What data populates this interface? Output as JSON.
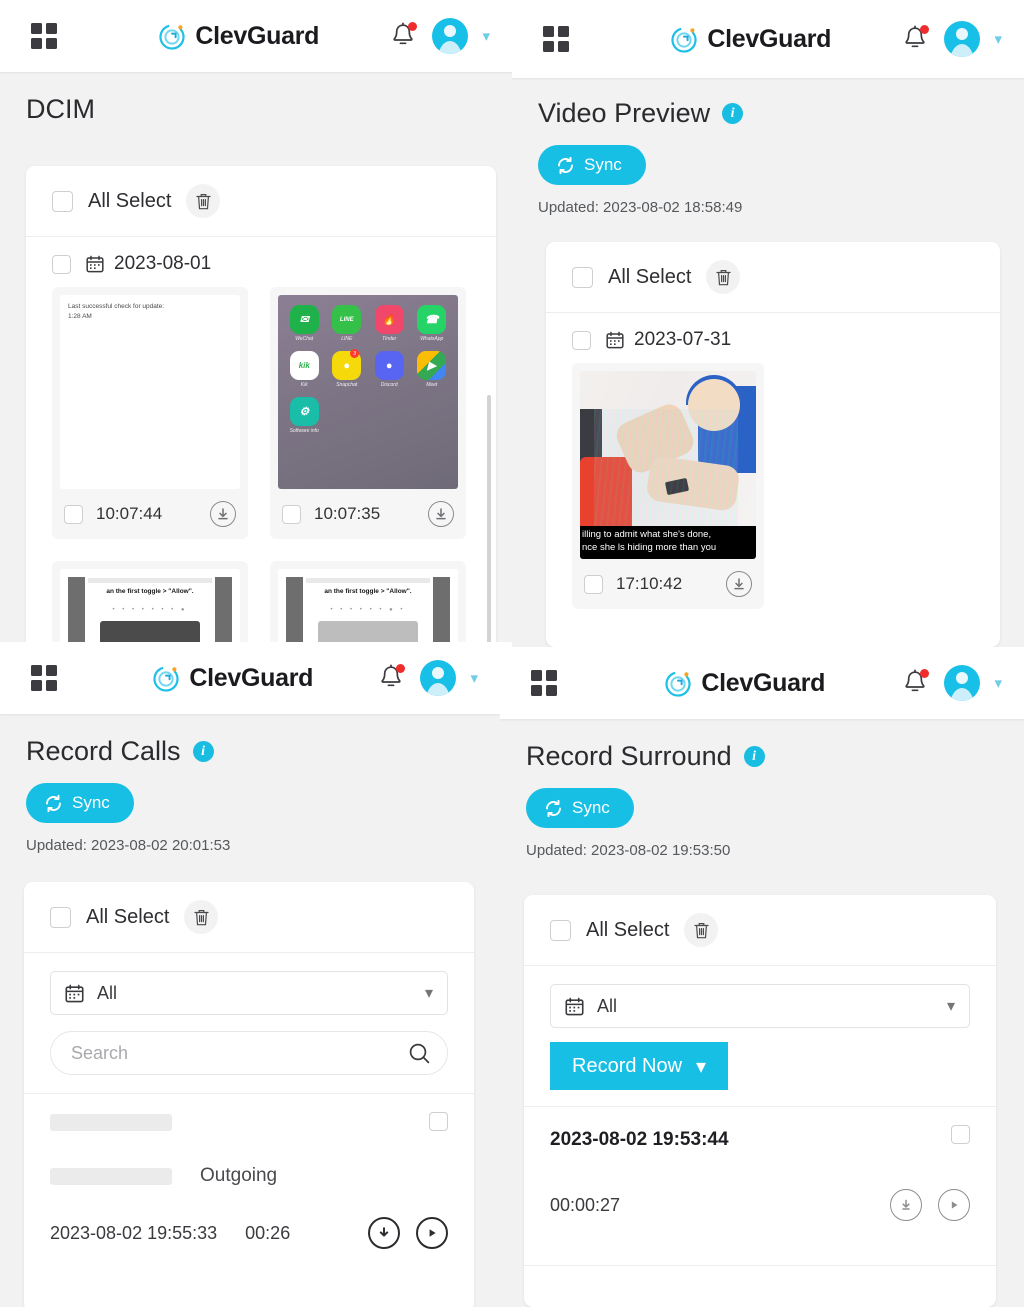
{
  "brand": {
    "name": "ClevGuard",
    "logo_icon": "clevguard-logo-icon"
  },
  "appbar": {
    "grid_icon": "grid-menu-icon",
    "bell_icon": "notification-bell-icon",
    "avatar_icon": "user-avatar-icon",
    "chevron_icon": "chevron-down-icon"
  },
  "panels": {
    "dcim": {
      "title": "DCIM",
      "all_select_label": "All Select",
      "delete_icon": "trash-icon",
      "date_group": "2023-08-01",
      "calendar_icon": "calendar-icon",
      "thumbnails": [
        {
          "time": "10:07:44",
          "kind": "note-screenshot",
          "text_line1": "Last successful check for update:",
          "text_line2": "1:28 AM",
          "download_icon": "download-icon"
        },
        {
          "time": "10:07:35",
          "kind": "app-drawer-screenshot",
          "apps": [
            {
              "name": "WeChat",
              "glyph": "✉",
              "color": "#20b24a"
            },
            {
              "name": "LINE",
              "glyph": "LINE",
              "color": "#35c04a"
            },
            {
              "name": "Tinder",
              "glyph": "🔥",
              "color": "#f0476b"
            },
            {
              "name": "WhatsApp",
              "glyph": "✆",
              "color": "#25d366"
            },
            {
              "name": "Kik",
              "glyph": "kik",
              "color": "#ffffff"
            },
            {
              "name": "Snapchat",
              "glyph": "●",
              "color": "#f5d90a",
              "badge": "3"
            },
            {
              "name": "Discord",
              "glyph": "●",
              "color": "#5865f2"
            },
            {
              "name": "Meet",
              "glyph": "▶",
              "color": "#ffffff"
            },
            {
              "name": "Software info",
              "glyph": "⚙",
              "color": "#19bda8"
            }
          ],
          "download_icon": "download-icon"
        },
        {
          "kind": "doc-screenshot",
          "title": "an the first toggle > \"Allow\".",
          "dots": "• • • • • • • ●"
        },
        {
          "kind": "doc-screenshot",
          "title": "an the first toggle > \"Allow\".",
          "dots": "• • • • • • ● •"
        }
      ]
    },
    "video_preview": {
      "title": "Video Preview",
      "info_icon": "info-icon",
      "sync_label": "Sync",
      "sync_icon": "sync-icon",
      "updated": "Updated: 2023-08-02 18:58:49",
      "all_select_label": "All Select",
      "delete_icon": "trash-icon",
      "calendar_icon": "calendar-icon",
      "date_group": "2023-07-31",
      "thumbnail": {
        "time": "17:10:42",
        "caption_line1": "illing to admit what she's done,",
        "caption_line2": "nce she ls hiding more than you",
        "download_icon": "download-icon"
      }
    },
    "record_calls": {
      "title": "Record Calls",
      "info_icon": "info-icon",
      "sync_label": "Sync",
      "sync_icon": "sync-icon",
      "updated": "Updated: 2023-08-02 20:01:53",
      "all_select_label": "All Select",
      "delete_icon": "trash-icon",
      "date_filter": {
        "value": "All",
        "calendar_icon": "calendar-icon",
        "caret_icon": "chevron-down-icon"
      },
      "search": {
        "value": "",
        "placeholder": "Search",
        "icon": "search-icon"
      },
      "row": {
        "contact_redacted": true,
        "direction": "Outgoing",
        "timestamp": "2023-08-02 19:55:33",
        "duration": "00:26",
        "download_icon": "download-icon",
        "play_icon": "play-icon"
      }
    },
    "record_surround": {
      "title": "Record Surround",
      "info_icon": "info-icon",
      "sync_label": "Sync",
      "sync_icon": "sync-icon",
      "updated": "Updated: 2023-08-02 19:53:50",
      "all_select_label": "All Select",
      "delete_icon": "trash-icon",
      "date_filter": {
        "value": "All",
        "calendar_icon": "calendar-icon",
        "caret_icon": "chevron-down-icon"
      },
      "record_now_label": "Record Now",
      "record_now_caret": "chevron-down-icon",
      "row": {
        "timestamp": "2023-08-02 19:53:44",
        "duration": "00:00:27",
        "download_icon": "download-icon",
        "play_icon": "play-icon"
      }
    }
  },
  "colors": {
    "accent": "#18bfe4",
    "badge_red": "#f02d2d",
    "page_bg": "#f2f2f2"
  }
}
